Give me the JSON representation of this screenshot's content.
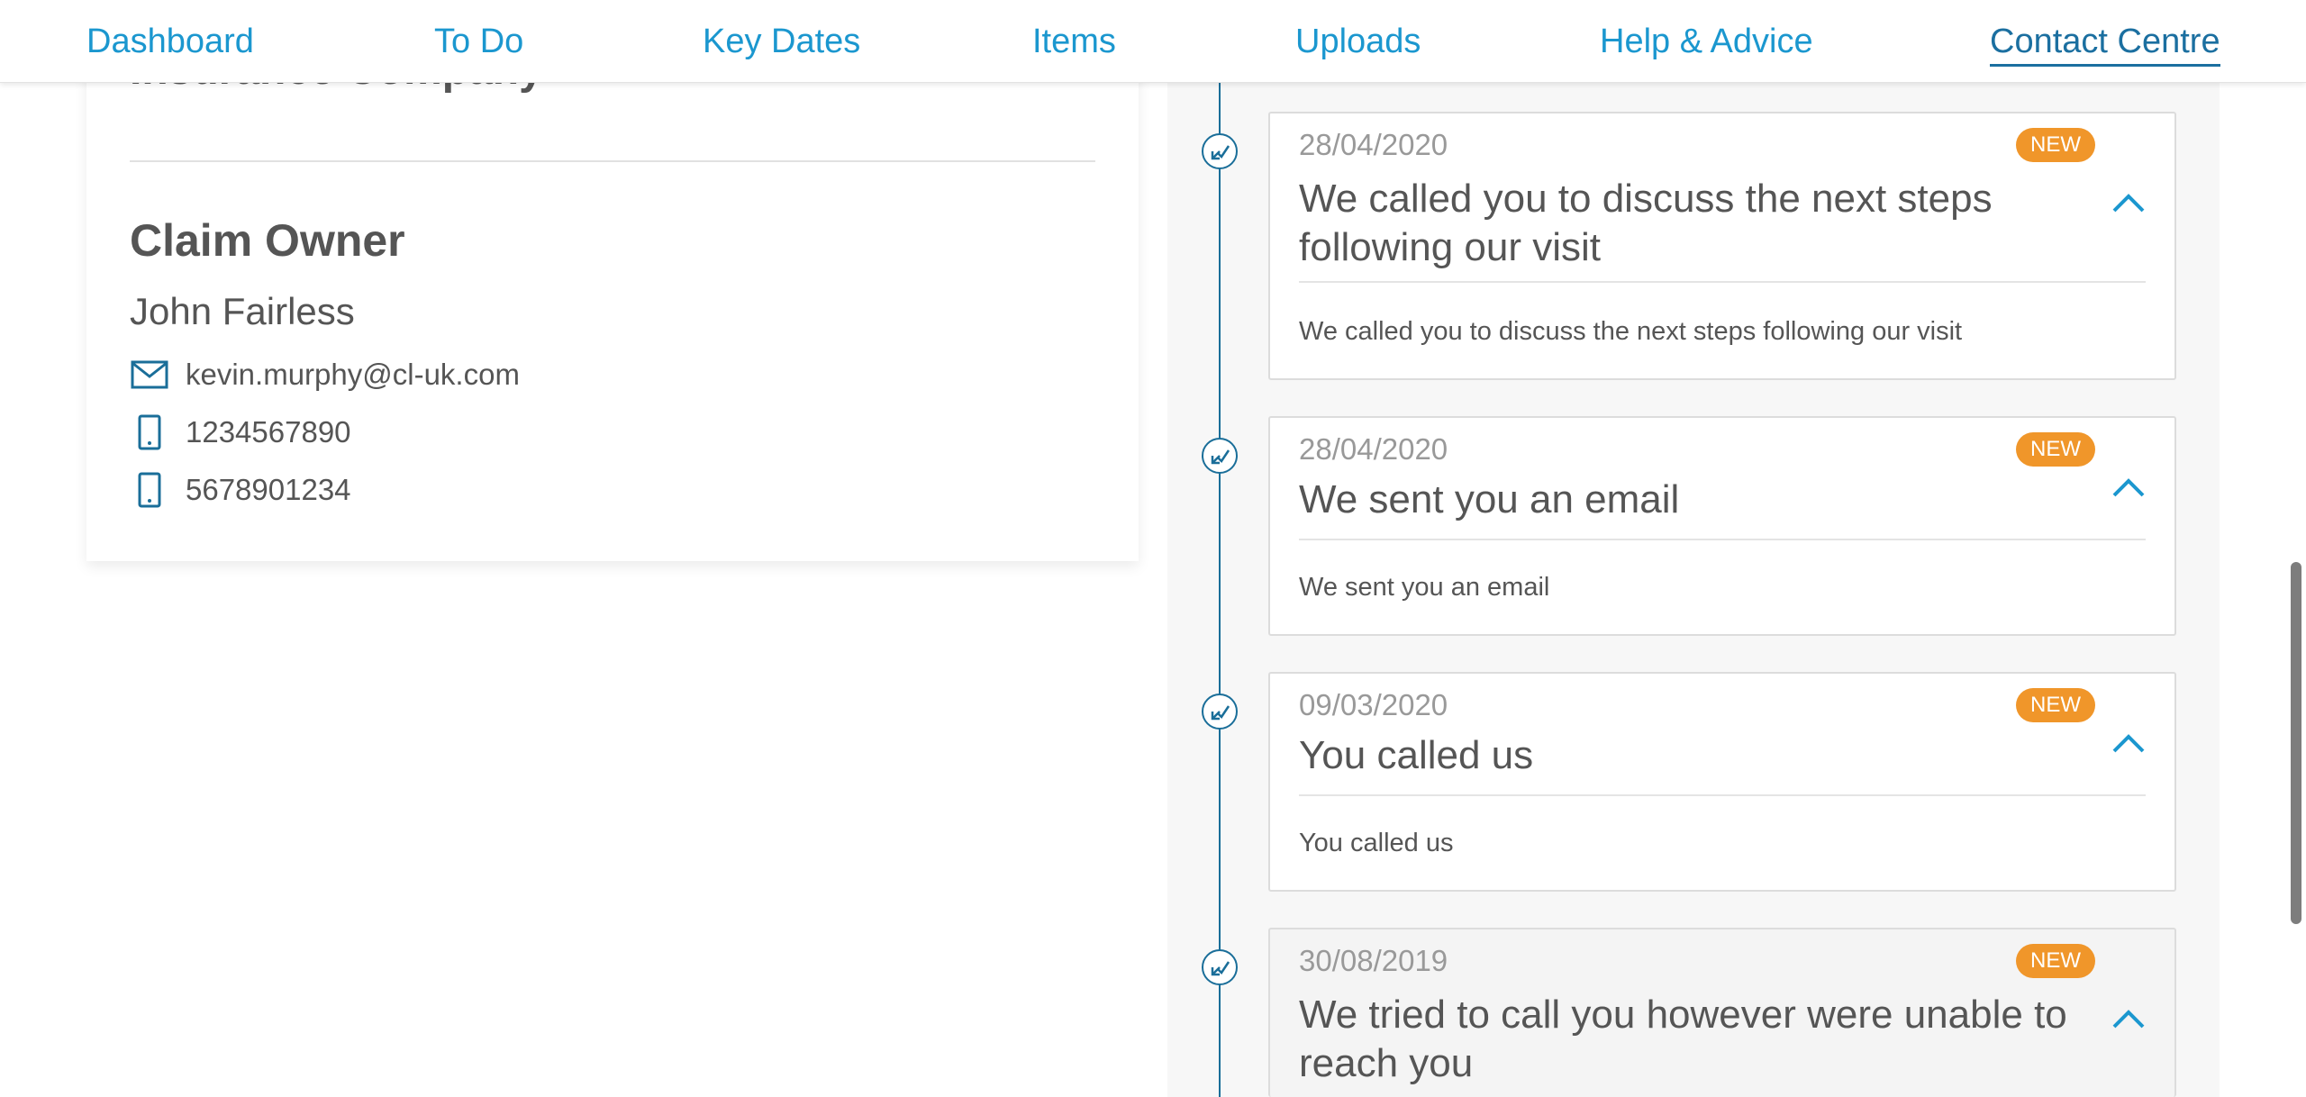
{
  "nav": {
    "items": [
      {
        "label": "Dashboard"
      },
      {
        "label": "To Do"
      },
      {
        "label": "Key Dates"
      },
      {
        "label": "Items"
      },
      {
        "label": "Uploads"
      },
      {
        "label": "Help & Advice"
      },
      {
        "label": "Contact Centre"
      }
    ],
    "active": "Contact Centre"
  },
  "left": {
    "insurer_heading": "Insurance Company",
    "owner_heading": "Claim Owner",
    "owner_name": "John Fairless",
    "email": "kevin.murphy@cl-uk.com",
    "phone_1": "1234567890",
    "phone_2": "5678901234"
  },
  "timeline": {
    "events": [
      {
        "date": "28/04/2020",
        "badge": "NEW",
        "title": "We called you to discuss the next steps following our visit",
        "body": "We called you to discuss the next steps following our visit"
      },
      {
        "date": "28/04/2020",
        "badge": "NEW",
        "title": "We sent you an email",
        "body": "We sent you an email"
      },
      {
        "date": "09/03/2020",
        "badge": "NEW",
        "title": "You called us",
        "body": "You called us"
      },
      {
        "date": "30/08/2019",
        "badge": "NEW",
        "title": "We tried to call you however were unable to reach you",
        "body": ""
      }
    ]
  },
  "colors": {
    "link": "#1b97cf",
    "timeline": "#1a6e99",
    "badge": "#f0962a",
    "text": "#555555"
  },
  "icons": {
    "email": "envelope-icon",
    "phone": "mobile-phone-icon",
    "timeline_node": "phone-call-icon",
    "expand": "chevron-up-icon"
  }
}
